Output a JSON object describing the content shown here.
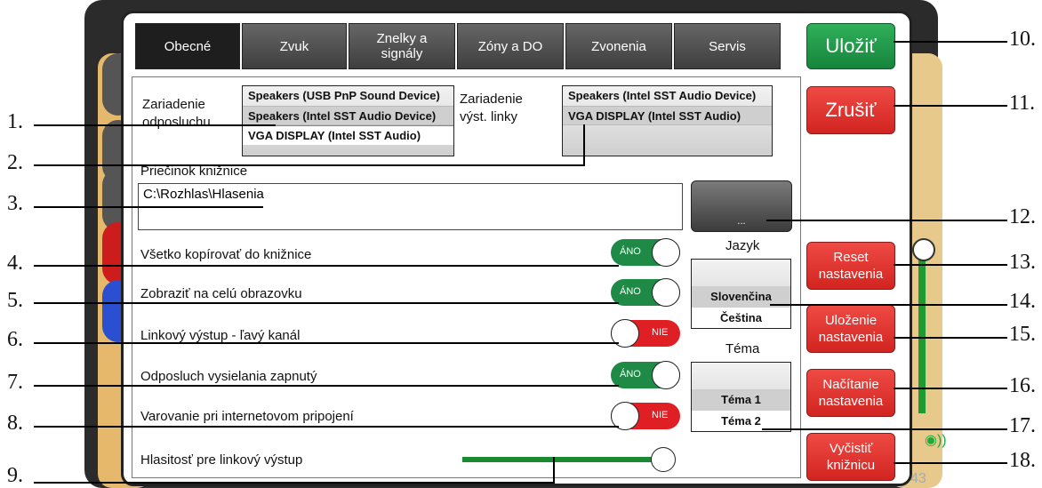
{
  "tabs": [
    {
      "label": "Obecné",
      "active": true
    },
    {
      "label": "Zvuk"
    },
    {
      "label": "Znelky a\nsignály"
    },
    {
      "label": "Zóny a DO"
    },
    {
      "label": "Zvonenia"
    },
    {
      "label": "Servis"
    }
  ],
  "buttons": {
    "save": "Uložiť",
    "cancel": "Zrušiť",
    "browse": "...",
    "reset": "Reset\nnastavenia",
    "save_settings": "Uloženie\nnastavenia",
    "load_settings": "Načítanie\nnastavenia",
    "clear_library": "Vyčistiť\nknižnicu"
  },
  "monitor_device": {
    "label": "Zariadenie\nodposluchu",
    "options": [
      "Speakers (USB PnP Sound Device)",
      "Speakers (Intel SST Audio Device)",
      "VGA DISPLAY (Intel SST Audio)"
    ]
  },
  "line_device": {
    "label": "Zariadenie\nvýst. linky",
    "options": [
      "Speakers (Intel SST Audio Device)",
      "VGA DISPLAY (Intel SST Audio)",
      ""
    ]
  },
  "library": {
    "label": "Priečinok knižnice",
    "path": "C:\\Rozhlas\\Hlasenia"
  },
  "toggles": {
    "copy_all": {
      "label": "Všetko kopírovať do knižnice",
      "state": "ÁNO"
    },
    "fullscreen": {
      "label": "Zobraziť na celú obrazovku",
      "state": "ÁNO"
    },
    "line_left": {
      "label": "Linkový výstup - ľavý kanál",
      "state": "NIE"
    },
    "monitoring": {
      "label": "Odposluch vysielania zapnutý",
      "state": "ÁNO"
    },
    "internet_warning": {
      "label": "Varovanie pri internetovom pripojení",
      "state": "NIE"
    }
  },
  "volume": {
    "label": "Hlasitosť pre linkový výstup",
    "level_fraction": 1.0
  },
  "language": {
    "label": "Jazyk",
    "options": [
      "",
      "Slovenčina",
      "Čeština"
    ],
    "selected": "Slovenčina"
  },
  "theme": {
    "label": "Téma",
    "options": [
      "",
      "Téma 1",
      "Téma 2"
    ],
    "selected": "Téma 2"
  },
  "callouts": [
    "1.",
    "2.",
    "3.",
    "4.",
    "5.",
    "6.",
    "7.",
    "8.",
    "9.",
    "10.",
    "11.",
    "12.",
    "13.",
    "14.",
    "15.",
    "16.",
    "17.",
    "18."
  ],
  "background": {
    "status_number": "43"
  },
  "colors": {
    "accent_green": "#1e9e49",
    "accent_red": "#e0221e",
    "tab_dark": "#1e1e1e"
  }
}
